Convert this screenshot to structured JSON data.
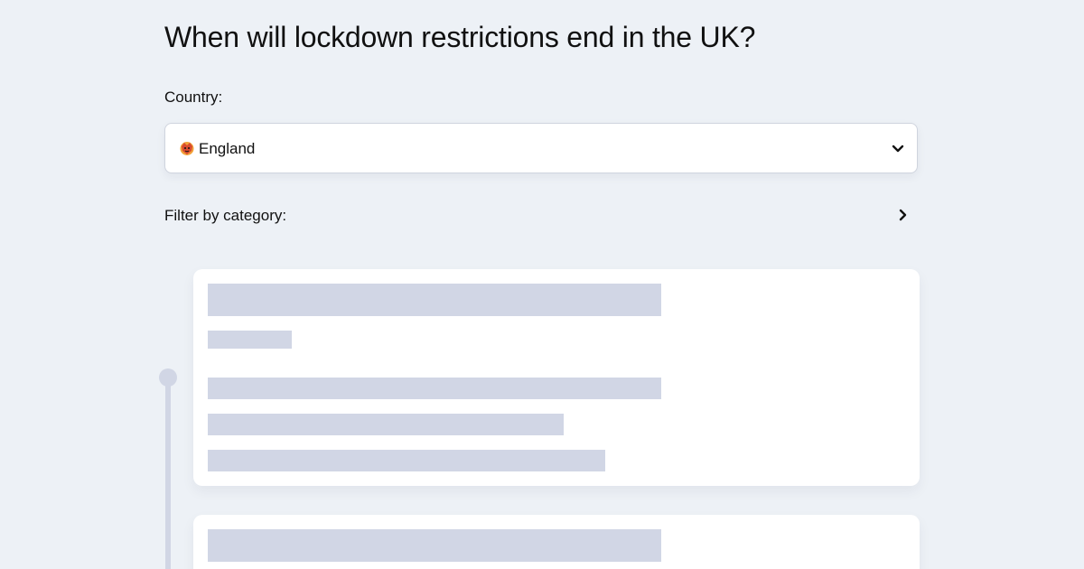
{
  "page": {
    "title": "When will lockdown restrictions end in the UK?"
  },
  "country_select": {
    "label": "Country:",
    "selected_value": "England",
    "flag_icon": "england-flag-icon",
    "dropdown_icon": "chevron-down-icon"
  },
  "filter": {
    "label": "Filter by category:",
    "expand_icon": "chevron-right-icon"
  },
  "colors": {
    "background": "#edf1f6",
    "card": "#ffffff",
    "skeleton": "#d1d6e5",
    "timeline": "#d1d6e5",
    "text": "#111111"
  }
}
